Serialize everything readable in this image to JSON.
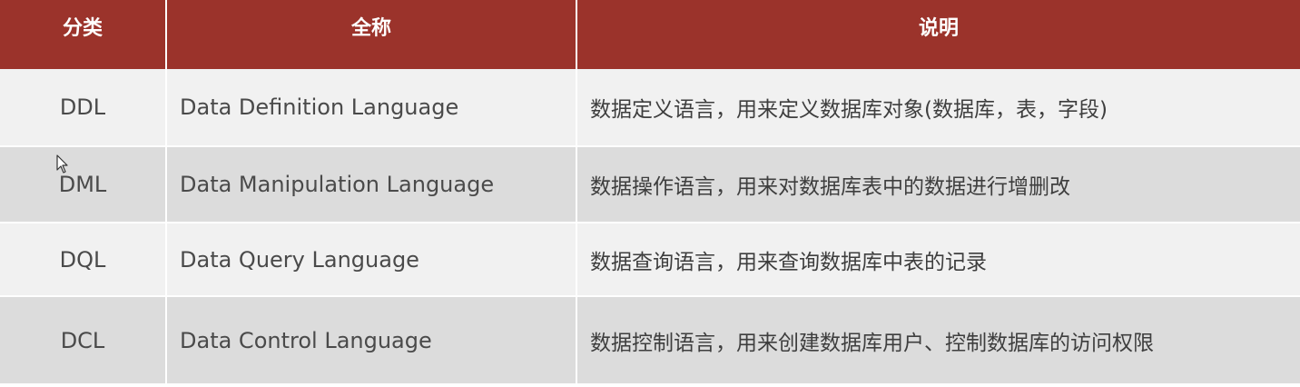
{
  "table": {
    "headers": {
      "category": "分类",
      "full_name": "全称",
      "description": "说明"
    },
    "rows": [
      {
        "category": "DDL",
        "full_name": "Data Definition Language",
        "description": "数据定义语言，用来定义数据库对象(数据库，表，字段)"
      },
      {
        "category": "DML",
        "full_name": "Data Manipulation Language",
        "description": "数据操作语言，用来对数据库表中的数据进行增删改"
      },
      {
        "category": "DQL",
        "full_name": "Data Query Language",
        "description": "数据查询语言，用来查询数据库中表的记录"
      },
      {
        "category": "DCL",
        "full_name": "Data Control Language",
        "description": "数据控制语言，用来创建数据库用户、控制数据库的访问权限"
      }
    ]
  },
  "colors": {
    "header_bg": "#9b332b",
    "row_odd": "#f1f1f1",
    "row_even": "#dcdcdc"
  },
  "icons": {
    "cursor": "mouse-pointer-icon"
  }
}
